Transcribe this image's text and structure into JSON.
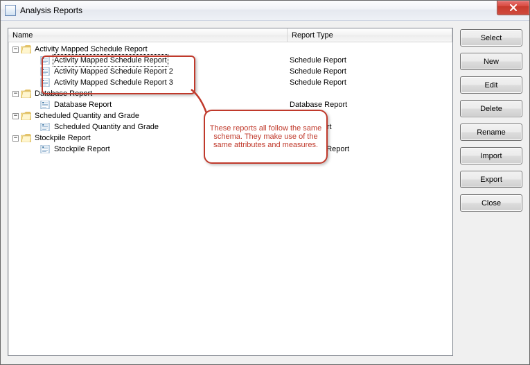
{
  "window": {
    "title": "Analysis Reports"
  },
  "columns": {
    "name": "Name",
    "type": "Report Type"
  },
  "tree": [
    {
      "level": 0,
      "expander": "-",
      "icon": "folder",
      "label": "Activity Mapped Schedule Report",
      "type": "",
      "selected": false
    },
    {
      "level": 1,
      "expander": "",
      "icon": "report",
      "label": "Activity Mapped Schedule Report",
      "type": "Schedule Report",
      "selected": true
    },
    {
      "level": 1,
      "expander": "",
      "icon": "report",
      "label": "Activity Mapped Schedule Report 2",
      "type": "Schedule Report",
      "selected": false
    },
    {
      "level": 1,
      "expander": "",
      "icon": "report",
      "label": "Activity Mapped Schedule Report 3",
      "type": "Schedule Report",
      "selected": false
    },
    {
      "level": 0,
      "expander": "-",
      "icon": "folder",
      "label": "Database Report",
      "type": "",
      "selected": false
    },
    {
      "level": 1,
      "expander": "",
      "icon": "report",
      "label": "Database Report",
      "type": "Database Report",
      "selected": false
    },
    {
      "level": 0,
      "expander": "-",
      "icon": "folder",
      "label": "Scheduled Quantity and Grade",
      "type": "",
      "selected": false
    },
    {
      "level": 1,
      "expander": "",
      "icon": "report",
      "label": "Scheduled Quantity and Grade",
      "type": "Pivot Report",
      "selected": false
    },
    {
      "level": 0,
      "expander": "-",
      "icon": "folder",
      "label": "Stockpile Report",
      "type": "",
      "selected": false
    },
    {
      "level": 1,
      "expander": "",
      "icon": "report",
      "label": "Stockpile Report",
      "type": "Stockpiles Report",
      "selected": false
    }
  ],
  "buttons": {
    "select": "Select",
    "new": "New",
    "edit": "Edit",
    "delete": "Delete",
    "rename": "Rename",
    "import": "Import",
    "export": "Export",
    "close": "Close"
  },
  "annotation": {
    "callout": "These reports all follow the same schema. They make use of the same attributes and measures."
  }
}
